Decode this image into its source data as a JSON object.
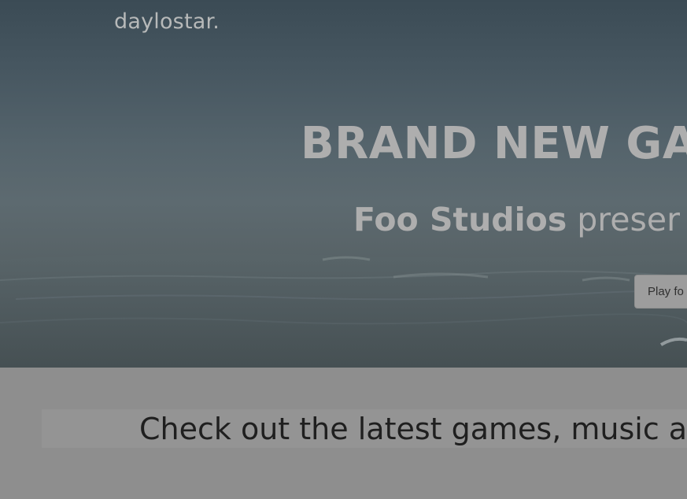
{
  "brand": {
    "logo_text": "daylostar."
  },
  "hero": {
    "headline": "BRAND NEW GA",
    "subline_studio": "Foo Studios",
    "subline_rest": " preser",
    "cta_label": "Play fo"
  },
  "promo": {
    "tagline": "Check out the latest games, music a"
  }
}
